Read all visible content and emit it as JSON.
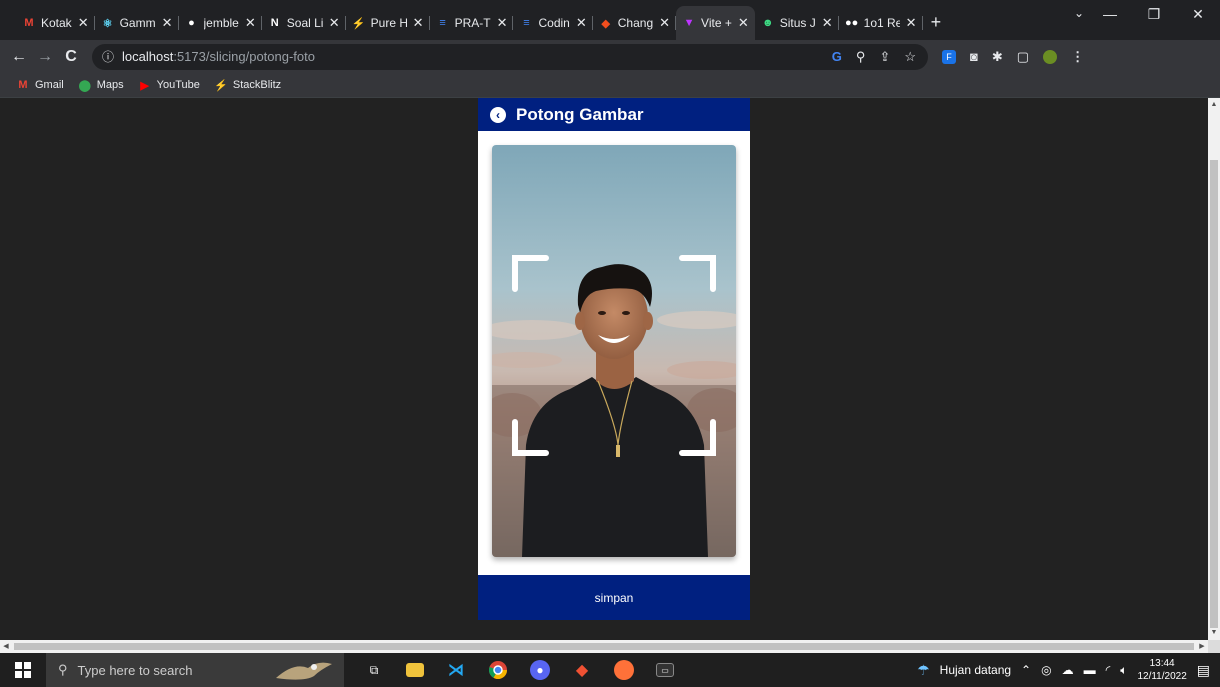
{
  "tabs": [
    {
      "label": "Kotak",
      "icon": "gmail-icon",
      "color": "#ea4335",
      "glyph": "M"
    },
    {
      "label": "Gamm",
      "icon": "react-icon",
      "color": "#61dafb",
      "glyph": "⚛"
    },
    {
      "label": "jemble",
      "icon": "github-icon",
      "color": "#ffffff",
      "glyph": "●"
    },
    {
      "label": "Soal Li",
      "icon": "notion-icon",
      "color": "#ffffff",
      "glyph": "N"
    },
    {
      "label": "Pure H",
      "icon": "stackblitz-icon",
      "color": "#1389fd",
      "glyph": "⚡"
    },
    {
      "label": "PRA-T",
      "icon": "docs-icon",
      "color": "#4285f4",
      "glyph": "≡"
    },
    {
      "label": "Codin",
      "icon": "docs-icon",
      "color": "#4285f4",
      "glyph": "≡"
    },
    {
      "label": "Chang",
      "icon": "figma-icon",
      "color": "#f24e1e",
      "glyph": "◆"
    },
    {
      "label": "Vite +",
      "icon": "vite-icon",
      "color": "#bd34fe",
      "glyph": "▼",
      "active": true
    },
    {
      "label": "Situs J",
      "icon": "frog-icon",
      "color": "#3ddc84",
      "glyph": "☻"
    },
    {
      "label": "1o1 Re",
      "icon": "dots-icon",
      "color": "#ffffff",
      "glyph": "●●"
    }
  ],
  "new_tab": "+",
  "window": {
    "minimize": "—",
    "restore": "❐",
    "close": "✕",
    "tab_search": "⌄"
  },
  "toolbar": {
    "back": "←",
    "forward": "→",
    "reload": "C",
    "info": "ⓘ",
    "url_host": "localhost",
    "url_path": ":5173/slicing/potong-foto",
    "omni_icons": [
      "G",
      "⚲",
      "⇪",
      "☆"
    ],
    "extensions": [
      "F",
      "◙",
      "✱",
      "▢"
    ],
    "menu": "⋮"
  },
  "bookmarks": [
    {
      "label": "Gmail",
      "icon": "gmail-icon",
      "glyph": "M",
      "color": "#ea4335"
    },
    {
      "label": "Maps",
      "icon": "maps-icon",
      "glyph": "⬤",
      "color": "#34a853"
    },
    {
      "label": "YouTube",
      "icon": "youtube-icon",
      "glyph": "▶",
      "color": "#ff0000"
    },
    {
      "label": "StackBlitz",
      "icon": "stackblitz-icon",
      "glyph": "⚡",
      "color": "#1389fd"
    }
  ],
  "app": {
    "title": "Potong Gambar",
    "back_glyph": "‹",
    "save_label": "simpan",
    "primary_color": "#002080"
  },
  "taskbar": {
    "search_placeholder": "Type here to search",
    "weather": "Hujan datang",
    "time": "13:44",
    "date": "12/11/2022"
  }
}
